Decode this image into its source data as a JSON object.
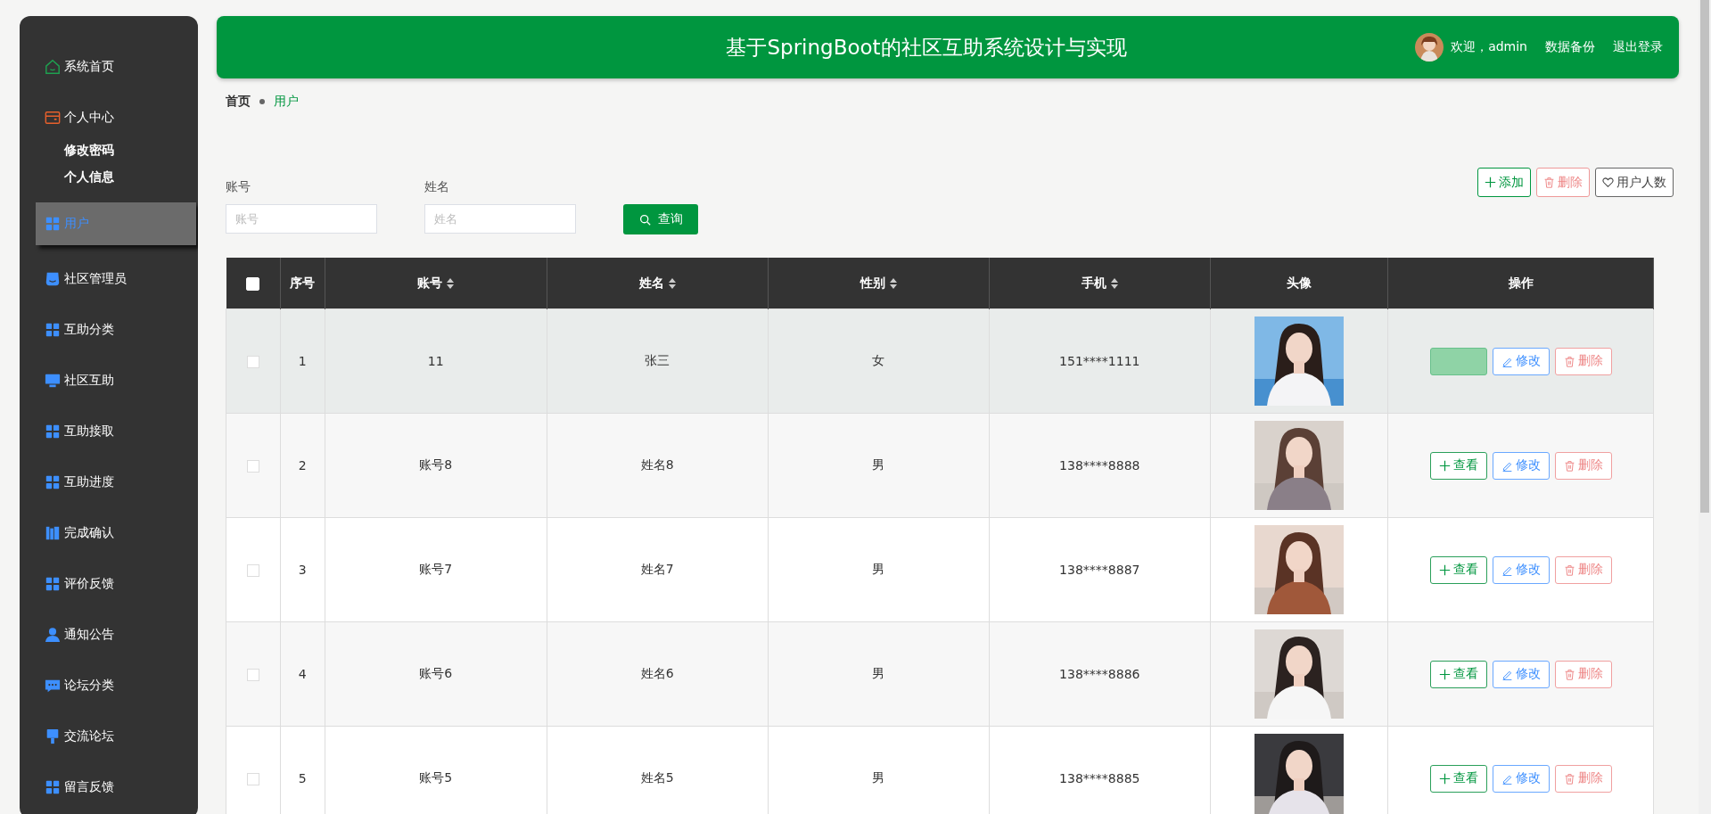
{
  "sidebar": {
    "items": [
      {
        "label": "系统首页",
        "kind": "home",
        "selected": false
      },
      {
        "label": "个人中心",
        "kind": "wallet",
        "selected": false,
        "children": [
          {
            "label": "修改密码"
          },
          {
            "label": "个人信息"
          }
        ]
      },
      {
        "label": "用户",
        "kind": "grid",
        "selected": true
      },
      {
        "label": "社区管理员",
        "kind": "shop",
        "selected": false
      },
      {
        "label": "互助分类",
        "kind": "grid",
        "selected": false
      },
      {
        "label": "社区互助",
        "kind": "monitor",
        "selected": false
      },
      {
        "label": "互助接取",
        "kind": "grid",
        "selected": false
      },
      {
        "label": "互助进度",
        "kind": "grid",
        "selected": false
      },
      {
        "label": "完成确认",
        "kind": "books",
        "selected": false
      },
      {
        "label": "评价反馈",
        "kind": "grid",
        "selected": false
      },
      {
        "label": "通知公告",
        "kind": "user",
        "selected": false
      },
      {
        "label": "论坛分类",
        "kind": "chat",
        "selected": false
      },
      {
        "label": "交流论坛",
        "kind": "stand",
        "selected": false
      },
      {
        "label": "留言反馈",
        "kind": "grid",
        "selected": false
      }
    ]
  },
  "header": {
    "title": "基于SpringBoot的社区互助系统设计与实现",
    "welcome": "欢迎，admin",
    "links": [
      "数据备份",
      "退出登录"
    ]
  },
  "breadcrumb": [
    {
      "label": "首页",
      "selected": false
    },
    {
      "label": "用户",
      "selected": true
    }
  ],
  "search": {
    "fields": [
      {
        "label": "账号",
        "placeholder": "账号"
      },
      {
        "label": "姓名",
        "placeholder": "姓名"
      }
    ],
    "button": "查询"
  },
  "toolbar": [
    {
      "kind": "add",
      "label": "添加"
    },
    {
      "kind": "delete",
      "label": "删除"
    },
    {
      "kind": "count",
      "label": "用户人数"
    }
  ],
  "table": {
    "select_all": {
      "checked": false
    },
    "columns": [
      {
        "label": "序号",
        "sortable": false
      },
      {
        "label": "账号",
        "sortable": true
      },
      {
        "label": "姓名",
        "sortable": true
      },
      {
        "label": "性别",
        "sortable": true
      },
      {
        "label": "手机",
        "sortable": true
      },
      {
        "label": "头像",
        "sortable": false
      },
      {
        "label": "操作",
        "sortable": false
      }
    ],
    "rows": [
      {
        "no": "1",
        "account": "11",
        "name": "张三",
        "gender": "女",
        "phone": "151****1111",
        "hovered": true,
        "actions": [
          {
            "kind": "view",
            "pressed": true
          },
          {
            "kind": "edit",
            "label": "修改",
            "pressed": false
          },
          {
            "kind": "delete",
            "label": "删除",
            "pressed": false
          }
        ]
      },
      {
        "no": "2",
        "account": "账号8",
        "name": "姓名8",
        "gender": "男",
        "phone": "138****8888",
        "hovered": false,
        "actions": [
          {
            "kind": "view",
            "label": "查看",
            "pressed": false
          },
          {
            "kind": "edit",
            "label": "修改",
            "pressed": false
          },
          {
            "kind": "delete",
            "label": "删除",
            "pressed": false
          }
        ]
      },
      {
        "no": "3",
        "account": "账号7",
        "name": "姓名7",
        "gender": "男",
        "phone": "138****8887",
        "hovered": false,
        "actions": [
          {
            "kind": "view",
            "label": "查看",
            "pressed": false
          },
          {
            "kind": "edit",
            "label": "修改",
            "pressed": false
          },
          {
            "kind": "delete",
            "label": "删除",
            "pressed": false
          }
        ]
      },
      {
        "no": "4",
        "account": "账号6",
        "name": "姓名6",
        "gender": "男",
        "phone": "138****8886",
        "hovered": false,
        "actions": [
          {
            "kind": "view",
            "label": "查看",
            "pressed": false
          },
          {
            "kind": "edit",
            "label": "修改",
            "pressed": false
          },
          {
            "kind": "delete",
            "label": "删除",
            "pressed": false
          }
        ]
      },
      {
        "no": "5",
        "account": "账号5",
        "name": "姓名5",
        "gender": "男",
        "phone": "138****8885",
        "hovered": false,
        "actions": [
          {
            "kind": "view",
            "label": "查看",
            "pressed": false
          },
          {
            "kind": "edit",
            "label": "修改",
            "pressed": false
          },
          {
            "kind": "delete",
            "label": "删除",
            "pressed": false
          }
        ]
      }
    ]
  }
}
